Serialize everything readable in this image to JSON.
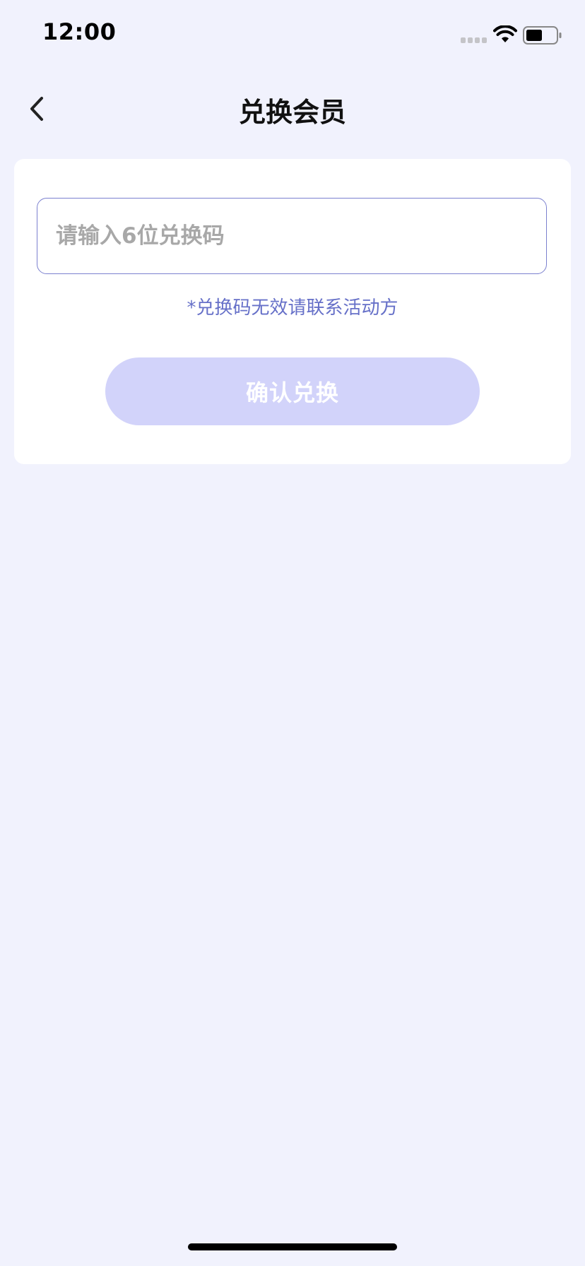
{
  "status_bar": {
    "time": "12:00",
    "icons": [
      "signal-icon",
      "wifi-icon",
      "battery-icon"
    ]
  },
  "nav": {
    "back_icon": "chevron-left-icon",
    "title": "兑换会员"
  },
  "redeem": {
    "code_value": "",
    "code_placeholder": "请输入6位兑换码",
    "hint": "*兑换码无效请联系活动方",
    "confirm_label": "确认兑换"
  },
  "colors": {
    "background": "#F1F2FD",
    "card": "#FFFFFF",
    "input_border": "#7B80CF",
    "hint": "#6670C8",
    "button_disabled": "#D2D3FA",
    "button_text": "#FFFFFF",
    "placeholder": "#A8A8A8"
  }
}
